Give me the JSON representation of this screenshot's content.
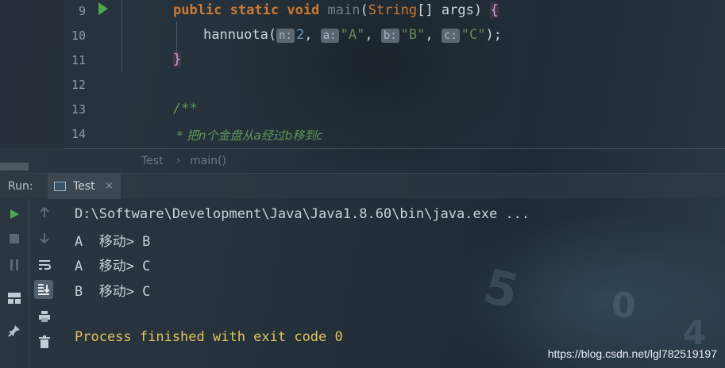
{
  "editor": {
    "lines": [
      {
        "num": "9"
      },
      {
        "num": "10"
      },
      {
        "num": "11"
      },
      {
        "num": "12"
      },
      {
        "num": "13"
      },
      {
        "num": "14"
      }
    ],
    "line9": {
      "kw1": "public",
      "kw2": "static",
      "kw3": "void",
      "fn": "main",
      "paren_open": "(",
      "type": "String",
      "rest": "[] args)",
      "brace": "{"
    },
    "line10": {
      "call": "hannuota(",
      "hint_n": "n:",
      "arg_n": "2",
      "hint_a": "a:",
      "arg_a": "\"A\"",
      "hint_b": "b:",
      "arg_b": "\"B\"",
      "hint_c": "c:",
      "arg_c": "\"C\"",
      "sep": ",",
      "end": ");"
    },
    "line11": {
      "brace": "}"
    },
    "line13": {
      "comment": "/**"
    },
    "line14": {
      "comment": " * 把n个金盘从a经过b移到c"
    }
  },
  "breadcrumb": {
    "class_name": "Test",
    "separator": "›",
    "method": "main()"
  },
  "run_panel": {
    "label": "Run:",
    "tab": {
      "label": "Test",
      "close": "×"
    }
  },
  "toolbar_icons": {
    "run": "play-icon",
    "stop": "stop-icon",
    "pause": "pause-icon",
    "layout": "layout-icon",
    "pin": "pin-icon",
    "up": "arrow-up-icon",
    "down": "arrow-down-icon",
    "wrap": "soft-wrap-icon",
    "scroll": "scroll-to-end-icon",
    "print": "print-icon",
    "trash": "trash-icon"
  },
  "console": {
    "lines": [
      "D:\\Software\\Development\\Java\\Java1.8.60\\bin\\java.exe ...",
      "A  移动> B",
      "A  移动> C",
      "B  移动> C"
    ],
    "exit": "Process finished with exit code 0"
  },
  "watermark": "https://blog.csdn.net/lgl782519197",
  "colors": {
    "keyword": "#cc7832",
    "string": "#6a8759",
    "number": "#6897bb",
    "comment": "#629755",
    "run_green": "#4fa652",
    "exit_text": "#e1c45a"
  }
}
